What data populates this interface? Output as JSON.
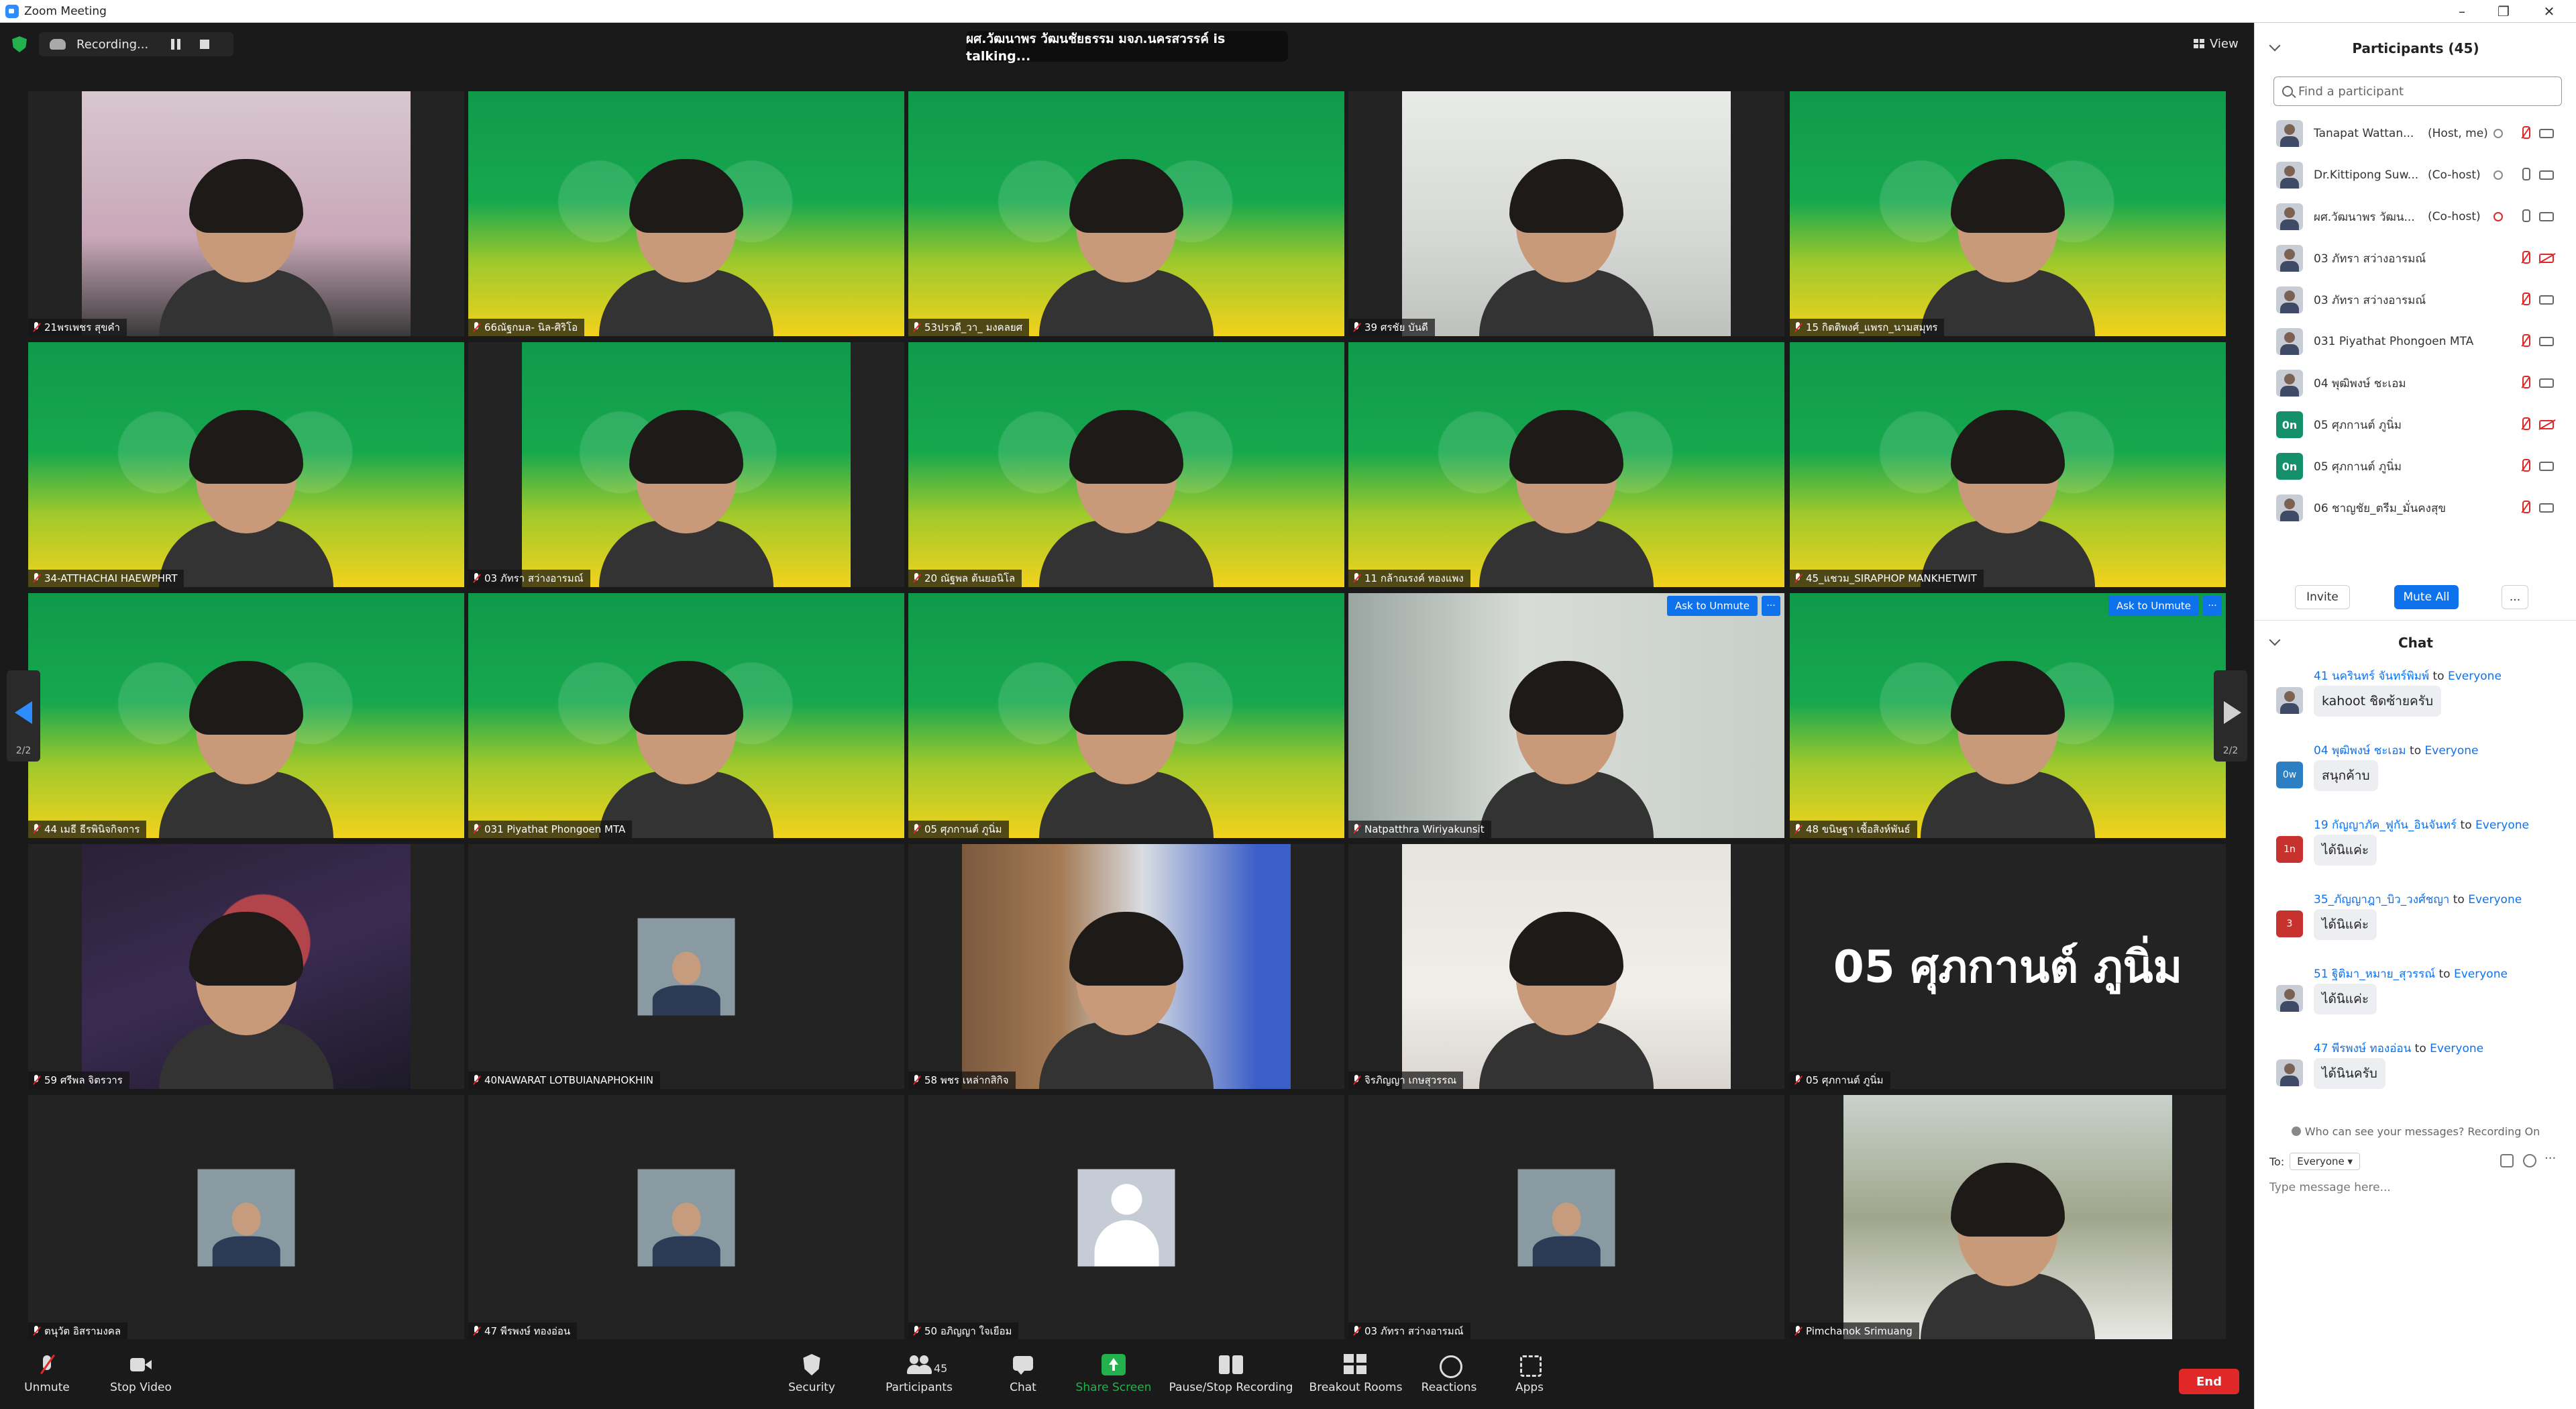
{
  "window": {
    "title": "Zoom Meeting",
    "controls": [
      "–",
      "❐",
      "✕"
    ]
  },
  "topbar": {
    "recording_label": "Recording...",
    "talking": "ผศ.วัฒนาพร วัฒนชัยธรรม มจภ.นครสวรรค์ is talking...",
    "view_label": "View"
  },
  "grid": {
    "page_indicator": "2/2",
    "tiles": [
      {
        "name": "21พรเพชร สุขคำ",
        "kind": "video",
        "bg": "room"
      },
      {
        "name": "66ณัฐกมล- นิล-ศิริโอ",
        "kind": "video",
        "bg": "green"
      },
      {
        "name": "53ปรวดี_วา_ มงคลยศ",
        "kind": "video",
        "bg": "green"
      },
      {
        "name": "39 ศรชัย บันดี",
        "kind": "video",
        "bg": "light"
      },
      {
        "name": "15 กิตติพงศ์_แพรก_นามสมุทร",
        "kind": "video",
        "bg": "green"
      },
      {
        "name": "34-ATTHACHAI HAEWPHRT",
        "kind": "video",
        "bg": "green"
      },
      {
        "name": "03 ภัทรา สว่างอารมณ์",
        "kind": "video",
        "bg": "green"
      },
      {
        "name": "20 ณัฐพล ต้นยอนิโล",
        "kind": "video",
        "bg": "green"
      },
      {
        "name": "11 กล้าณรงค์ ทองแพง",
        "kind": "video",
        "bg": "green"
      },
      {
        "name": "45_แชวม_SIRAPHOP MANKHETWIT",
        "kind": "video",
        "bg": "green"
      },
      {
        "name": "44 เมธี ธีรพินิจกิจการ",
        "kind": "video",
        "bg": "green"
      },
      {
        "name": "031 Piyathat Phongoen MTA",
        "kind": "video",
        "bg": "green"
      },
      {
        "name": "05 ศุภกานต์ ภูนิ่ม",
        "kind": "video",
        "bg": "green"
      },
      {
        "name": "Natpatthra Wiriyakunsit",
        "kind": "video",
        "bg": "kitchen",
        "ask": true
      },
      {
        "name": "48 ขนิษฐา เชื้อสิงห์พันธ์",
        "kind": "video",
        "bg": "green",
        "ask": true
      },
      {
        "name": "59 ศรีพล จิตรวาร",
        "kind": "video",
        "bg": "dark"
      },
      {
        "name": "40NAWARAT LOTBUIANAPHOKHIN",
        "kind": "photo"
      },
      {
        "name": "58 พชร เหล่ากสิกิจ",
        "kind": "video",
        "bg": "wood"
      },
      {
        "name": "จิรภิญญา เกษสุวรรณ",
        "kind": "video",
        "bg": "shop"
      },
      {
        "name": "05 ศุภกานต์ ภูนิ่ม",
        "kind": "text",
        "display": "05 ศุภกานต์ ภูนิ่ม"
      },
      {
        "name": "ตนุวัต อิสรามงคล",
        "kind": "photo"
      },
      {
        "name": "47 พีรพงษ์ ทองอ่อน",
        "kind": "photo"
      },
      {
        "name": "50 อภิญญา ใจเยือม",
        "kind": "avatar"
      },
      {
        "name": "03 ภัทรา สว่างอารมณ์",
        "kind": "photo"
      },
      {
        "name": "Pimchanok Srimuang",
        "kind": "video",
        "bg": "park"
      }
    ],
    "ask_to_unmute": "Ask to Unmute",
    "more": "···"
  },
  "toolbar": {
    "unmute": "Unmute",
    "stop_video": "Stop Video",
    "security": "Security",
    "participants": "Participants",
    "participant_count": "45",
    "chat": "Chat",
    "share_screen": "Share Screen",
    "pause_stop_recording": "Pause/Stop Recording",
    "breakout_rooms": "Breakout Rooms",
    "reactions": "Reactions",
    "apps": "Apps",
    "end": "End"
  },
  "participants_panel": {
    "title": "Participants (45)",
    "search_placeholder": "Find a participant",
    "rows": [
      {
        "name": "Tanapat Wattan...",
        "role": "(Host, me)",
        "mic": "off",
        "cam": "on",
        "avatar": "photo"
      },
      {
        "name": "Dr.Kittipong Suw...",
        "role": "(Co-host)",
        "mic": "on",
        "cam": "on",
        "avatar": "photo"
      },
      {
        "name": "ผศ.วัฒนาพร วัฒน...",
        "role": "(Co-host)",
        "mic": "on",
        "cam": "on",
        "avatar": "photo"
      },
      {
        "name": "03 ภัทรา สว่างอารมณ์",
        "role": "",
        "mic": "off",
        "cam": "off",
        "avatar": "photo"
      },
      {
        "name": "03 ภัทรา สว่างอารมณ์",
        "role": "",
        "mic": "off",
        "cam": "on",
        "avatar": "photo"
      },
      {
        "name": "031 Piyathat Phongoen MTA",
        "role": "",
        "mic": "off",
        "cam": "on",
        "avatar": "photo"
      },
      {
        "name": "04 พุฒิพงษ์ ชะเอม",
        "role": "",
        "mic": "off",
        "cam": "on",
        "avatar": "photo"
      },
      {
        "name": "05 ศุภกานต์ ภูนิ่ม",
        "role": "",
        "mic": "off",
        "cam": "off",
        "avatar": "0n"
      },
      {
        "name": "05 ศุภกานต์ ภูนิ่ม",
        "role": "",
        "mic": "off",
        "cam": "on",
        "avatar": "0n"
      },
      {
        "name": "06 ชาญชัย_ตรีม_มั่นคงสุข",
        "role": "",
        "mic": "off",
        "cam": "on",
        "avatar": "photo"
      }
    ],
    "invite": "Invite",
    "mute_all": "Mute All",
    "more": "..."
  },
  "chat_panel": {
    "title": "Chat",
    "messages": [
      {
        "from": "41 นครินทร์ จันทร์พิมพ์",
        "to": "to",
        "target": "Everyone",
        "text": "kahoot ชิดซ้ายครับ",
        "avatar": "photo",
        "color": "#c8ccd4"
      },
      {
        "from": "04 พุฒิพงษ์ ชะเอม",
        "to": "to",
        "target": "Everyone",
        "text": "สนุกค้าบ",
        "avatar": "0w",
        "color": "#2d7fc4"
      },
      {
        "from": "19 กัญญาภัค_ฟูกัน_อินจันทร์",
        "to": "to",
        "target": "Everyone",
        "text": "ได้นิแค่ะ",
        "avatar": "1n",
        "color": "#c8322e"
      },
      {
        "from": "35_ภัญญาฎา_บิว_วงศ์ชญา",
        "to": "to",
        "target": "Everyone",
        "text": "ได้นิแค่ะ",
        "avatar": "3",
        "color": "#c8322e"
      },
      {
        "from": "51 ฐิติมา_หมาย_สุวรรณ์",
        "to": "to",
        "target": "Everyone",
        "text": "ได้นิแค่ะ",
        "avatar": "photo",
        "color": "#c8ccd4"
      },
      {
        "from": "47 พีรพงษ์ ทองอ่อน",
        "to": "to",
        "target": "Everyone",
        "text": "ได้นินครับ",
        "avatar": "photo",
        "color": "#c8ccd4"
      }
    ],
    "who_can_see": "Who can see your messages? Recording On",
    "to_label": "To:",
    "to_value": "Everyone",
    "placeholder": "Type message here..."
  }
}
